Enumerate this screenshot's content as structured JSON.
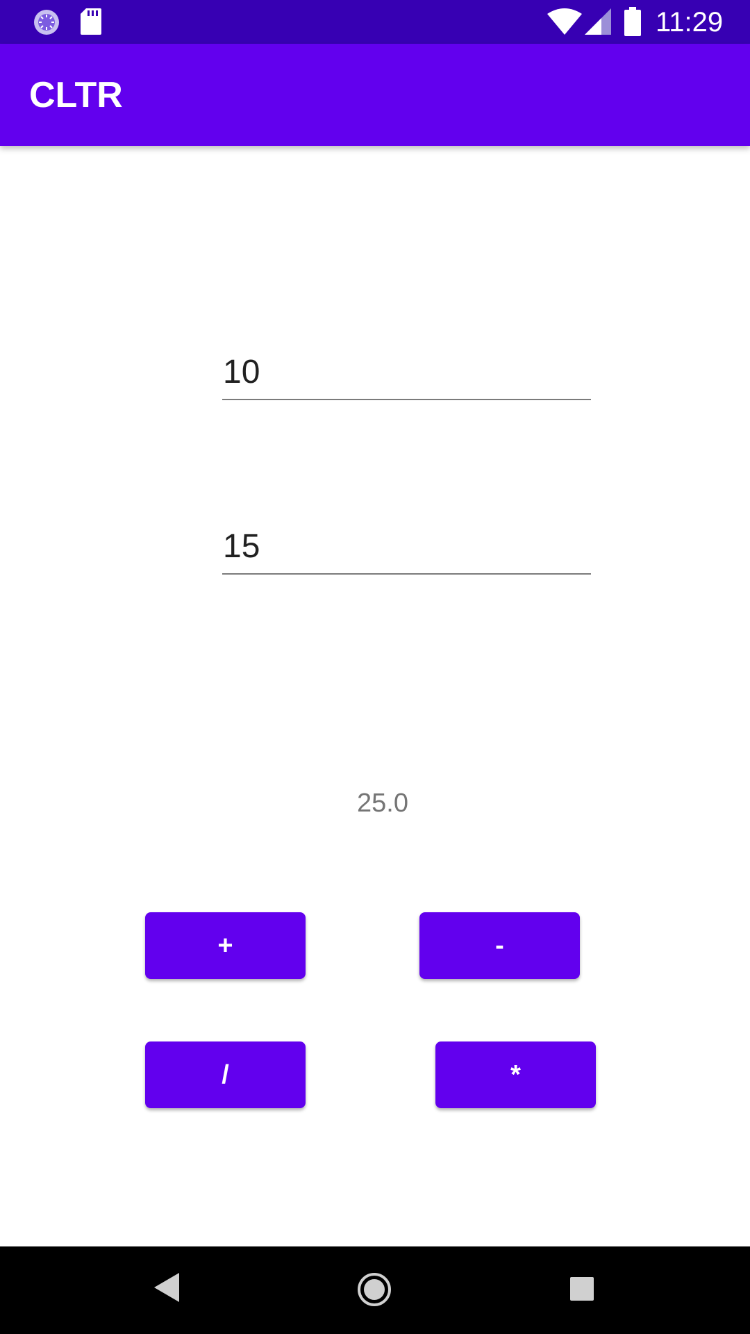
{
  "status_bar": {
    "time": "11:29",
    "background_color": "#3700b3",
    "icons": [
      "sync-icon",
      "sd-card-icon",
      "wifi-icon",
      "signal-icon",
      "battery-icon"
    ]
  },
  "app_bar": {
    "title": "CLTR",
    "background_color": "#6200ee"
  },
  "inputs": {
    "first_number": "10",
    "second_number": "15"
  },
  "result": {
    "value": "25.0"
  },
  "buttons": {
    "add": "+",
    "subtract": "-",
    "divide": "/",
    "multiply": "*",
    "color": "#6200ee"
  },
  "nav_bar": {
    "icons": [
      "back-icon",
      "home-icon",
      "recents-icon"
    ]
  }
}
